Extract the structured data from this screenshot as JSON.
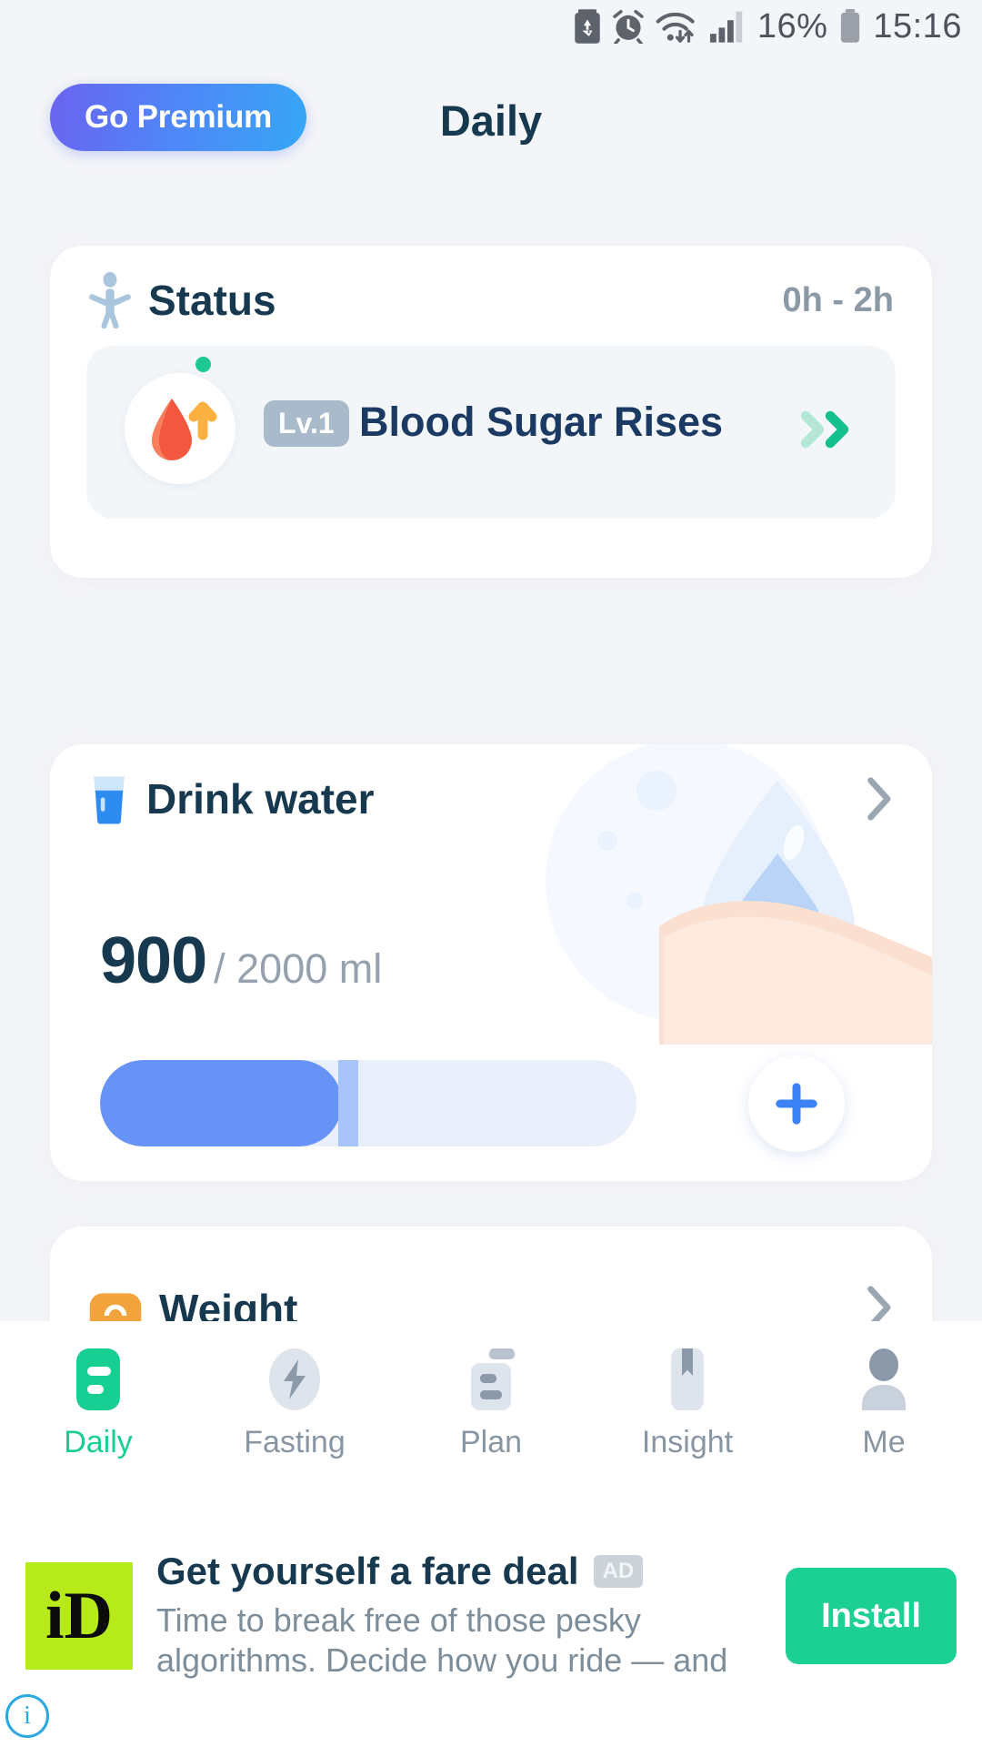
{
  "status_bar": {
    "battery_percent": "16%",
    "time": "15:16",
    "icons": [
      "battery-saver-icon",
      "alarm-icon",
      "wifi-icon",
      "cellular-signal-icon",
      "battery-icon"
    ]
  },
  "header": {
    "premium_label": "Go Premium",
    "title": "Daily"
  },
  "status_card": {
    "title": "Status",
    "icon": "person-icon",
    "time_range": "0h - 2h",
    "entry": {
      "icon": "blood-drop-rising-icon",
      "level": "Lv.1",
      "label": "Blood Sugar Rises",
      "chevron": "double-chevron-right-icon",
      "indicator_color": "#1fc795"
    }
  },
  "water_card": {
    "title": "Drink water",
    "icon": "water-glass-icon",
    "chevron": "chevron-right-icon",
    "current": "900",
    "goal": "/ 2000 ml",
    "progress_percent": 45,
    "fill_color": "#6793f7",
    "add_button": "+"
  },
  "weight_card": {
    "title": "Weight",
    "icon": "scale-icon"
  },
  "bottom_nav": {
    "active_color": "#17cf93",
    "items": [
      {
        "label": "Daily",
        "icon": "daily-list-icon"
      },
      {
        "label": "Fasting",
        "icon": "lightning-bolt-icon"
      },
      {
        "label": "Plan",
        "icon": "plan-document-icon"
      },
      {
        "label": "Insight",
        "icon": "bookmark-icon"
      },
      {
        "label": "Me",
        "icon": "person-avatar-icon"
      }
    ]
  },
  "ad": {
    "brand_initials": "iD",
    "title": "Get yourself a fare deal",
    "tag": "AD",
    "description": "Time to break free of those pesky algorithms. Decide how you ride — and fo...",
    "cta": "Install",
    "info": "i"
  }
}
